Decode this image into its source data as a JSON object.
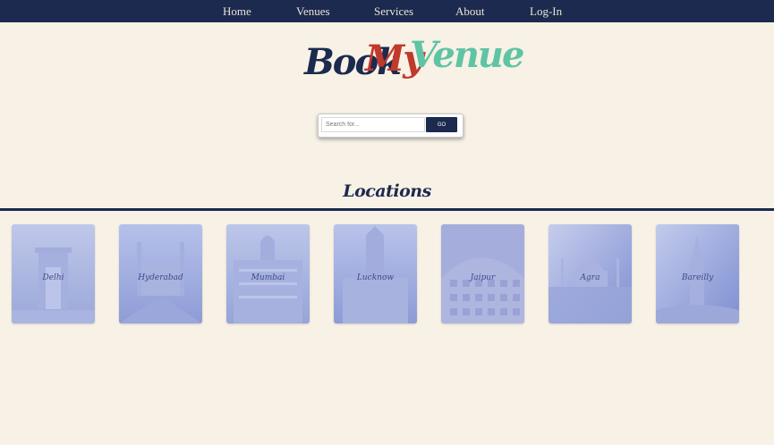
{
  "nav": {
    "items": [
      "Home",
      "Venues",
      "Services",
      "About",
      "Log-In"
    ]
  },
  "logo": {
    "word1": "Book",
    "word2": "My",
    "word3": "Venue",
    "colors": {
      "word1": "#1b2a4e",
      "word2": "#c0392b",
      "word3": "#5fc4a4"
    }
  },
  "search": {
    "placeholder": "Search for...",
    "button_label": "GO"
  },
  "locations": {
    "title": "Locations",
    "cards": [
      {
        "label": "Delhi",
        "icon": "india-gate"
      },
      {
        "label": "Hyderabad",
        "icon": "charminar"
      },
      {
        "label": "Mumbai",
        "icon": "taj-hotel"
      },
      {
        "label": "Lucknow",
        "icon": "clock-tower"
      },
      {
        "label": "Jaipur",
        "icon": "hawa-mahal"
      },
      {
        "label": "Agra",
        "icon": "taj-mahal"
      },
      {
        "label": "Bareilly",
        "icon": "temple"
      }
    ]
  },
  "colors": {
    "navy": "#1b2a4e",
    "background": "#f8f1e6",
    "card_tint": "#8c9fd8"
  }
}
